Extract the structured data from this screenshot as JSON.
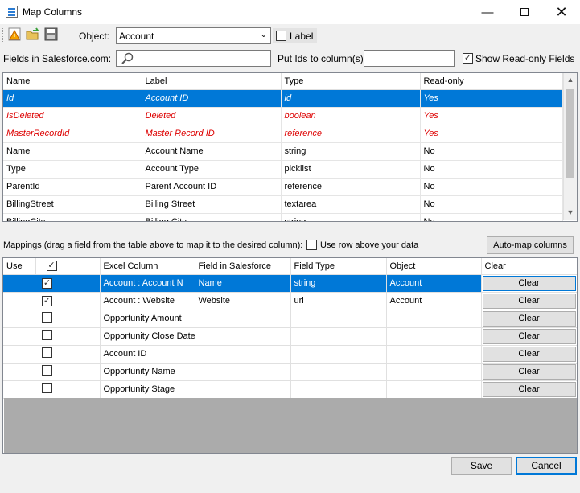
{
  "window": {
    "title": "Map Columns",
    "controls": [
      "minimize-icon",
      "maximize-icon",
      "close-icon"
    ]
  },
  "toolbar": {
    "icons": [
      "warning-icon",
      "open-folder-icon",
      "save-icon"
    ],
    "object_label": "Object:",
    "object_value": "Account",
    "label_checkbox": "Label",
    "fields_label": "Fields in Salesforce.com:",
    "search_value": "",
    "put_ids_label": "Put Ids to column(s):",
    "put_ids_value": "",
    "show_readonly_label": "Show Read-only Fields",
    "show_readonly_checked": true
  },
  "fields_table": {
    "columns": [
      "Name",
      "Label",
      "Type",
      "Read-only"
    ],
    "rows": [
      {
        "name": "Id",
        "label": "Account ID",
        "type": "id",
        "readonly": "Yes"
      },
      {
        "name": "IsDeleted",
        "label": "Deleted",
        "type": "boolean",
        "readonly": "Yes"
      },
      {
        "name": "MasterRecordId",
        "label": "Master Record ID",
        "type": "reference",
        "readonly": "Yes"
      },
      {
        "name": "Name",
        "label": "Account Name",
        "type": "string",
        "readonly": "No"
      },
      {
        "name": "Type",
        "label": "Account Type",
        "type": "picklist",
        "readonly": "No"
      },
      {
        "name": "ParentId",
        "label": "Parent Account ID",
        "type": "reference",
        "readonly": "No"
      },
      {
        "name": "BillingStreet",
        "label": "Billing Street",
        "type": "textarea",
        "readonly": "No"
      },
      {
        "name": "BillingCity",
        "label": "Billing City",
        "type": "string",
        "readonly": "No"
      }
    ]
  },
  "mappings": {
    "label": "Mappings (drag a field from the table above to map it to the desired column):",
    "use_row_above_label": "Use row above your data",
    "automap_button": "Auto-map columns",
    "columns": [
      "Use",
      "",
      "Excel Column",
      "Field in Salesforce",
      "Field Type",
      "Object",
      "Clear"
    ],
    "header_checked": true,
    "rows": [
      {
        "checked": true,
        "excel": "Account : Account N",
        "field": "Name",
        "type": "string",
        "object": "Account",
        "clear": "Clear"
      },
      {
        "checked": true,
        "excel": "Account : Website",
        "field": "Website",
        "type": "url",
        "object": "Account",
        "clear": "Clear"
      },
      {
        "checked": false,
        "excel": "Opportunity Amount",
        "field": "",
        "type": "",
        "object": "",
        "clear": "Clear"
      },
      {
        "checked": false,
        "excel": "Opportunity Close Date",
        "field": "",
        "type": "",
        "object": "",
        "clear": "Clear"
      },
      {
        "checked": false,
        "excel": "Account ID",
        "field": "",
        "type": "",
        "object": "",
        "clear": "Clear"
      },
      {
        "checked": false,
        "excel": "Opportunity Name",
        "field": "",
        "type": "",
        "object": "",
        "clear": "Clear"
      },
      {
        "checked": false,
        "excel": "Opportunity Stage",
        "field": "",
        "type": "",
        "object": "",
        "clear": "Clear"
      }
    ]
  },
  "footer": {
    "save_label": "Save",
    "cancel_label": "Cancel"
  }
}
